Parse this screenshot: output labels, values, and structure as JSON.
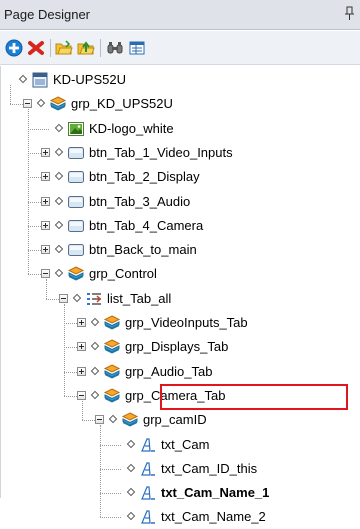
{
  "panel": {
    "title": "Page Designer"
  },
  "toolbar": {
    "buttons": [
      {
        "icon": "add-icon"
      },
      {
        "icon": "delete-icon"
      },
      {
        "icon": "folder-open-icon"
      },
      {
        "icon": "folder-up-icon"
      },
      {
        "icon": "find-icon"
      },
      {
        "icon": "properties-icon"
      }
    ]
  },
  "tree": {
    "nodes": [
      {
        "label": "KD-UPS52U",
        "icon": "page-icon",
        "expander": "none",
        "selected": false
      },
      {
        "label": "grp_KD_UPS52U",
        "icon": "group-icon",
        "expander": "expanded",
        "selected": false
      },
      {
        "label": "KD-logo_white",
        "icon": "image-icon",
        "expander": "none",
        "selected": false
      },
      {
        "label": "btn_Tab_1_Video_Inputs",
        "icon": "button-icon",
        "expander": "collapsed",
        "selected": false
      },
      {
        "label": "btn_Tab_2_Display",
        "icon": "button-icon",
        "expander": "collapsed",
        "selected": false
      },
      {
        "label": "btn_Tab_3_Audio",
        "icon": "button-icon",
        "expander": "collapsed",
        "selected": false
      },
      {
        "label": "btn_Tab_4_Camera",
        "icon": "button-icon",
        "expander": "collapsed",
        "selected": false
      },
      {
        "label": "btn_Back_to_main",
        "icon": "button-icon",
        "expander": "collapsed",
        "selected": false
      },
      {
        "label": "grp_Control",
        "icon": "group-icon",
        "expander": "expanded",
        "selected": false
      },
      {
        "label": "list_Tab_all",
        "icon": "list-icon",
        "expander": "expanded",
        "selected": false
      },
      {
        "label": "grp_VideoInputs_Tab",
        "icon": "group-icon",
        "expander": "collapsed",
        "selected": false
      },
      {
        "label": "grp_Displays_Tab",
        "icon": "group-icon",
        "expander": "collapsed",
        "selected": false
      },
      {
        "label": "grp_Audio_Tab",
        "icon": "group-icon",
        "expander": "collapsed",
        "selected": false
      },
      {
        "label": "grp_Camera_Tab",
        "icon": "group-icon",
        "expander": "expanded",
        "selected": false
      },
      {
        "label": "grp_camID",
        "icon": "group-icon",
        "expander": "expanded",
        "selected": false
      },
      {
        "label": "txt_Cam",
        "icon": "text-icon",
        "expander": "none",
        "selected": false
      },
      {
        "label": "txt_Cam_ID_this",
        "icon": "text-icon",
        "expander": "none",
        "selected": false
      },
      {
        "label": "txt_Cam_Name_1",
        "icon": "text-icon",
        "expander": "none",
        "selected": true
      },
      {
        "label": "txt_Cam_Name_2",
        "icon": "text-icon",
        "expander": "none",
        "selected": false
      }
    ]
  },
  "colors": {
    "highlight_border": "#e0161d",
    "header_bg": "#dfe3e9",
    "toolbar_bg": "#eef1f5"
  }
}
